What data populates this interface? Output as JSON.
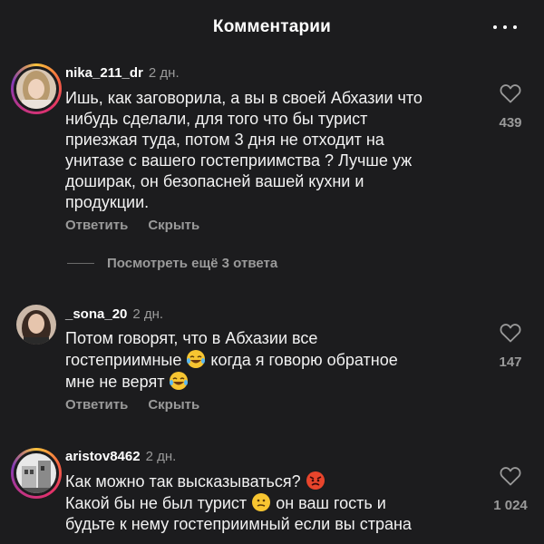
{
  "header": {
    "title": "Комментарии",
    "more_icon": "more-horizontal-icon"
  },
  "colors": {
    "background": "#1c1c1e",
    "text": "#f2f2f2",
    "secondary": "#9a9a9a",
    "story_ring": [
      "#f9c23c",
      "#f56040",
      "#e1306c",
      "#c13584",
      "#833ab4"
    ]
  },
  "comments": [
    {
      "username": "nika_211_dr",
      "time": "2 дн.",
      "lines": [
        "Ишь, как заговорила, а вы в своей Абхазии что",
        "нибудь сделали, для того что бы турист",
        "приезжая туда, потом 3 дня не отходит на",
        "унитазе с вашего гостеприимства ? Лучше уж",
        "доширак, он безопасней вашей кухни и",
        "продукции."
      ],
      "reply_label": "Ответить",
      "hide_label": "Скрыть",
      "likes": "439",
      "view_replies": "Посмотреть ещё 3 ответа"
    },
    {
      "username": "_sona_20",
      "time": "2 дн.",
      "line1": "Потом говорят, что в Абхазии все",
      "line2_a": "гостеприимные",
      "line2_emoji": "tears-of-joy-emoji",
      "line2_b": "когда я говорю обратное",
      "line3_a": "мне не верят",
      "line3_emoji": "tears-of-joy-emoji",
      "reply_label": "Ответить",
      "hide_label": "Скрыть",
      "likes": "147"
    },
    {
      "username": "aristov8462",
      "time": "2 дн.",
      "line1_a": "Как можно так высказываться?",
      "line1_emoji": "angry-face-emoji",
      "line2_a": "Какой бы не был турист",
      "line2_emoji": "confused-face-emoji",
      "line2_b": "он ваш гость и",
      "line3": "будьте к нему гостеприимный если вы страна",
      "likes": "1 024"
    }
  ]
}
